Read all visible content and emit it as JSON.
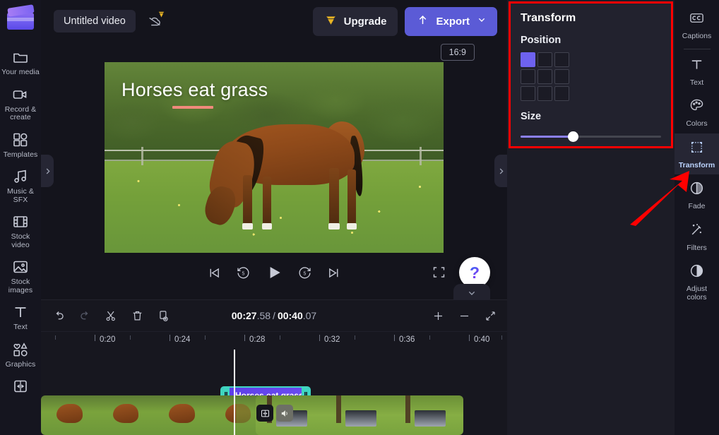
{
  "app": {
    "brand_logo": "clipchamp-logo",
    "accent_purple": "#5b5bd6",
    "accent_teal": "#3fd5c0",
    "annotation_red": "#ff0000"
  },
  "topbar": {
    "project_title": "Untitled video",
    "cloud_icon": "cloud-off-icon",
    "gem_badge_icon": "gem-icon",
    "upgrade_label": "Upgrade",
    "upgrade_icon": "gem-icon",
    "export_label": "Export",
    "export_icon": "upload-icon",
    "export_chevron": "chevron-down-icon"
  },
  "left_rail": {
    "items": [
      {
        "label": "Your media",
        "icon": "folder-icon"
      },
      {
        "label": "Record & create",
        "icon": "video-camera-icon"
      },
      {
        "label": "Templates",
        "icon": "templates-icon"
      },
      {
        "label": "Music & SFX",
        "icon": "music-note-icon"
      },
      {
        "label": "Stock video",
        "icon": "film-strip-icon"
      },
      {
        "label": "Stock images",
        "icon": "image-icon"
      },
      {
        "label": "Text",
        "icon": "text-t-icon"
      },
      {
        "label": "Graphics",
        "icon": "shapes-icon"
      },
      {
        "label": "Transitions",
        "icon": "transition-icon"
      }
    ]
  },
  "preview": {
    "aspect_ratio": "16:9",
    "overlay_text": "Horses eat grass",
    "underline_color": "#f08a7c",
    "collapse_left_icon": "chevron-right-icon",
    "collapse_right_icon": "chevron-right-icon",
    "controls": [
      {
        "name": "skip-to-start",
        "icon": "skip-back-icon"
      },
      {
        "name": "rewind-5",
        "icon": "rewind-5-icon"
      },
      {
        "name": "play",
        "icon": "play-icon"
      },
      {
        "name": "forward-5",
        "icon": "forward-5-icon"
      },
      {
        "name": "skip-to-end",
        "icon": "skip-forward-icon"
      }
    ],
    "fullscreen_icon": "fullscreen-icon",
    "help_label": "?",
    "panel_chevron_icon": "chevron-down-icon"
  },
  "timeline": {
    "tools": [
      {
        "name": "undo",
        "icon": "undo-icon",
        "enabled": true
      },
      {
        "name": "redo",
        "icon": "redo-icon",
        "enabled": false
      },
      {
        "name": "split",
        "icon": "scissors-icon",
        "enabled": true
      },
      {
        "name": "delete",
        "icon": "trash-icon",
        "enabled": true
      },
      {
        "name": "duplicate",
        "icon": "duplicate-icon",
        "enabled": true
      }
    ],
    "current_time": "00:27",
    "current_frac": ".58",
    "separator": "/",
    "total_time": "00:40",
    "total_frac": ".07",
    "zoom_in_icon": "plus-icon",
    "zoom_out_icon": "minus-icon",
    "fit_icon": "fit-to-screen-icon",
    "ruler_labels": [
      "0:20",
      "0:24",
      "0:28",
      "0:32",
      "0:36",
      "0:40"
    ],
    "text_clip_label": "Horses eat grass",
    "clip_badges": [
      {
        "name": "transition-badge",
        "icon": "transition-icon"
      },
      {
        "name": "audio-badge",
        "icon": "speaker-icon"
      }
    ]
  },
  "transform_panel": {
    "title": "Transform",
    "position_label": "Position",
    "position_selected_index": 0,
    "position_cells": 9,
    "size_label": "Size",
    "size_value_pct": 37
  },
  "right_rail": {
    "items": [
      {
        "label": "Captions",
        "icon": "closed-captions-icon",
        "active": false
      },
      {
        "label": "Text",
        "icon": "text-t-icon",
        "active": false
      },
      {
        "label": "Colors",
        "icon": "palette-icon",
        "active": false
      },
      {
        "label": "Transform",
        "icon": "transform-icon",
        "active": true
      },
      {
        "label": "Fade",
        "icon": "fade-icon",
        "active": false
      },
      {
        "label": "Filters",
        "icon": "magic-wand-icon",
        "active": false
      },
      {
        "label": "Adjust colors",
        "icon": "contrast-icon",
        "active": false
      }
    ]
  }
}
